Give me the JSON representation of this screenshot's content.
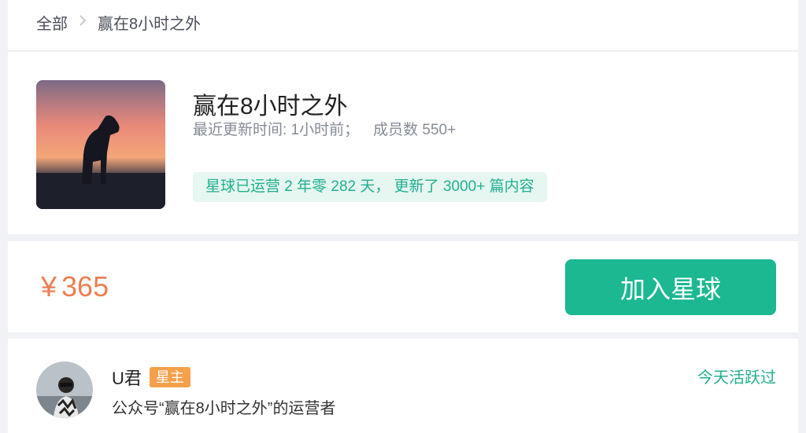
{
  "breadcrumb": {
    "items": [
      "全部",
      "赢在8小时之外"
    ]
  },
  "group": {
    "title": "赢在8小时之外",
    "updated_label": "最近更新时间: 1小时前；",
    "members_label": "成员数 550+",
    "stats": "星球已运营 2 年零 282 天， 更新了 3000+ 篇内容"
  },
  "purchase": {
    "currency": "¥",
    "price": "365",
    "join_label": "加入星球"
  },
  "owner": {
    "name": "U君",
    "badge": "星主",
    "bio": "公众号“赢在8小时之外”的运营者",
    "activity": "今天活跃过"
  },
  "colors": {
    "accent": "#1bb891",
    "price": "#ee7e52",
    "badge": "#f5a04b"
  }
}
